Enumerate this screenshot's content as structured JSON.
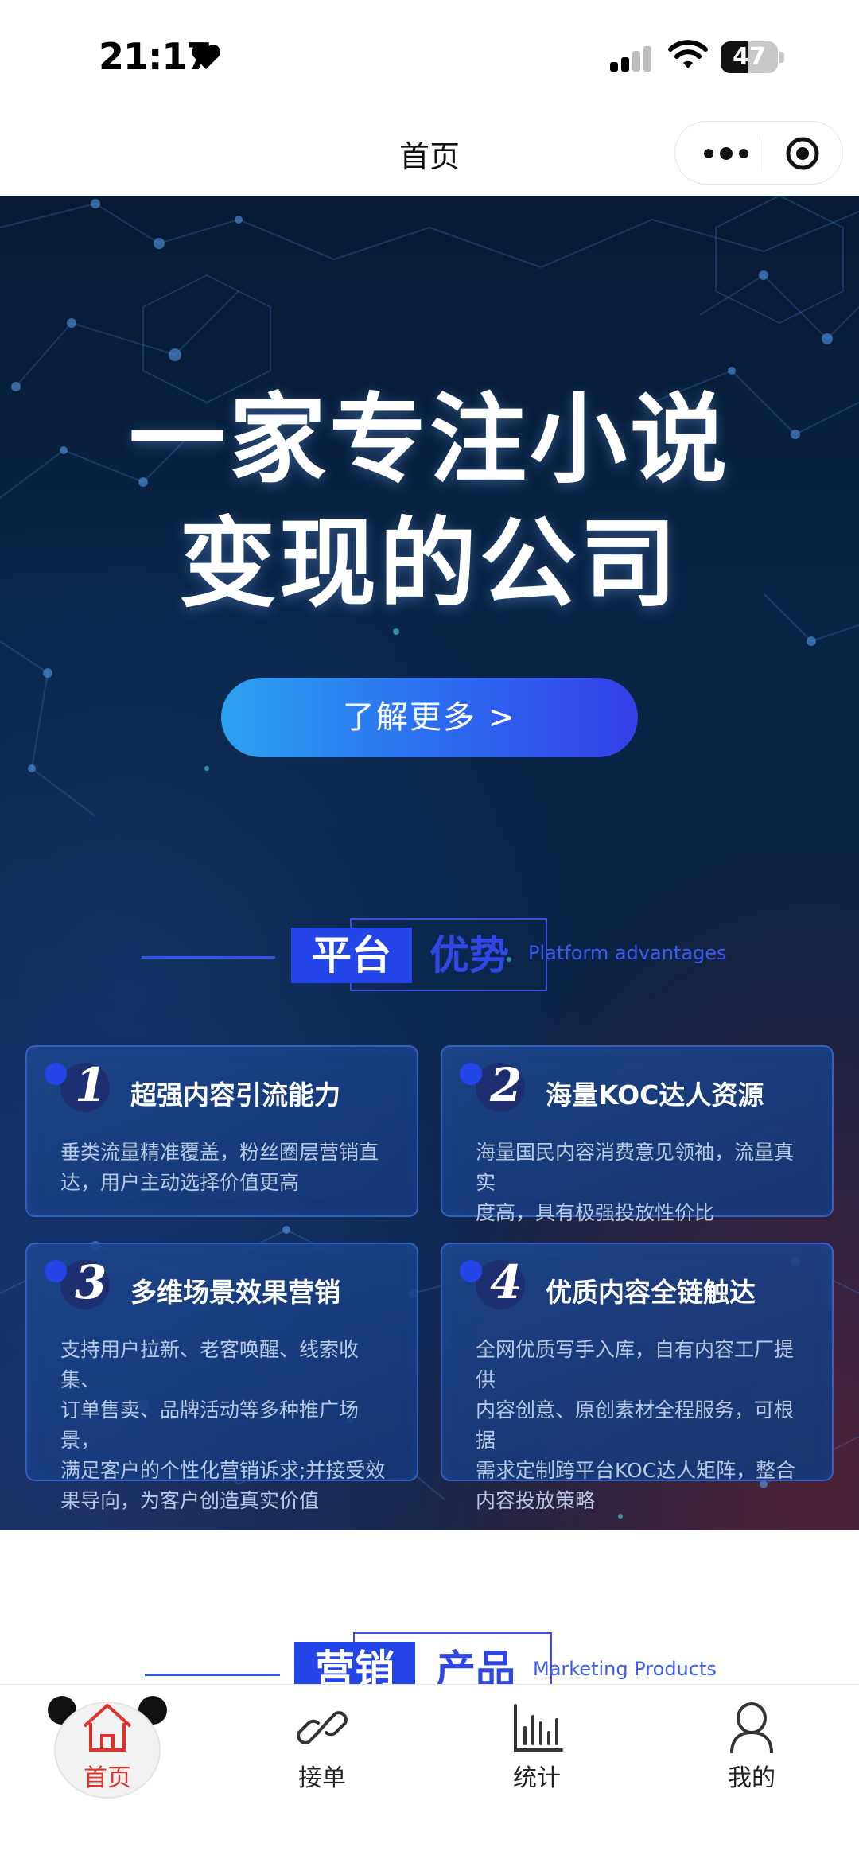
{
  "status_bar": {
    "time": "21:17",
    "battery": "47",
    "battery_level": 0.47
  },
  "nav": {
    "title": "首页"
  },
  "hero": {
    "headline_line1": "一家专注小说",
    "headline_line2": "变现的公司",
    "cta_label": "了解更多 >"
  },
  "section1": {
    "title_part1": "平台",
    "title_part2": "优势",
    "subtitle": "Platform advantages"
  },
  "cards": [
    {
      "num": "1",
      "title": "超强内容引流能力",
      "lines": [
        "垂类流量精准覆盖，粉丝圈层营销直",
        "达，用户主动选择价值更高"
      ]
    },
    {
      "num": "2",
      "title": "海量KOC达人资源",
      "lines": [
        "海量国民内容消费意见领袖，流量真实",
        "度高，具有极强投放性价比"
      ]
    },
    {
      "num": "3",
      "title": "多维场景效果营销",
      "lines": [
        "支持用户拉新、老客唤醒、线索收集、",
        "订单售卖、品牌活动等多种推广场景，",
        "满足客户的个性化营销诉求;并接受效",
        "果导向，为客户创造真实价值"
      ]
    },
    {
      "num": "4",
      "title": "优质内容全链触达",
      "lines": [
        "全网优质写手入库，自有内容工厂提供",
        "内容创意、原创素材全程服务，可根据",
        "需求定制跨平台KOC达人矩阵，整合",
        "内容投放策略"
      ]
    }
  ],
  "section2": {
    "title_part1": "营销",
    "title_part2": "产品",
    "subtitle": "Marketing Products"
  },
  "tabbar": {
    "tabs": [
      {
        "label": "首页",
        "icon": "home-icon",
        "active": true
      },
      {
        "label": "接单",
        "icon": "link-icon",
        "active": false
      },
      {
        "label": "统计",
        "icon": "chart-icon",
        "active": false
      },
      {
        "label": "我的",
        "icon": "person-icon",
        "active": false
      }
    ]
  },
  "colors": {
    "accent": "#2446e8",
    "active_tab": "#e0322a",
    "hero_bg": "#0a2446"
  }
}
